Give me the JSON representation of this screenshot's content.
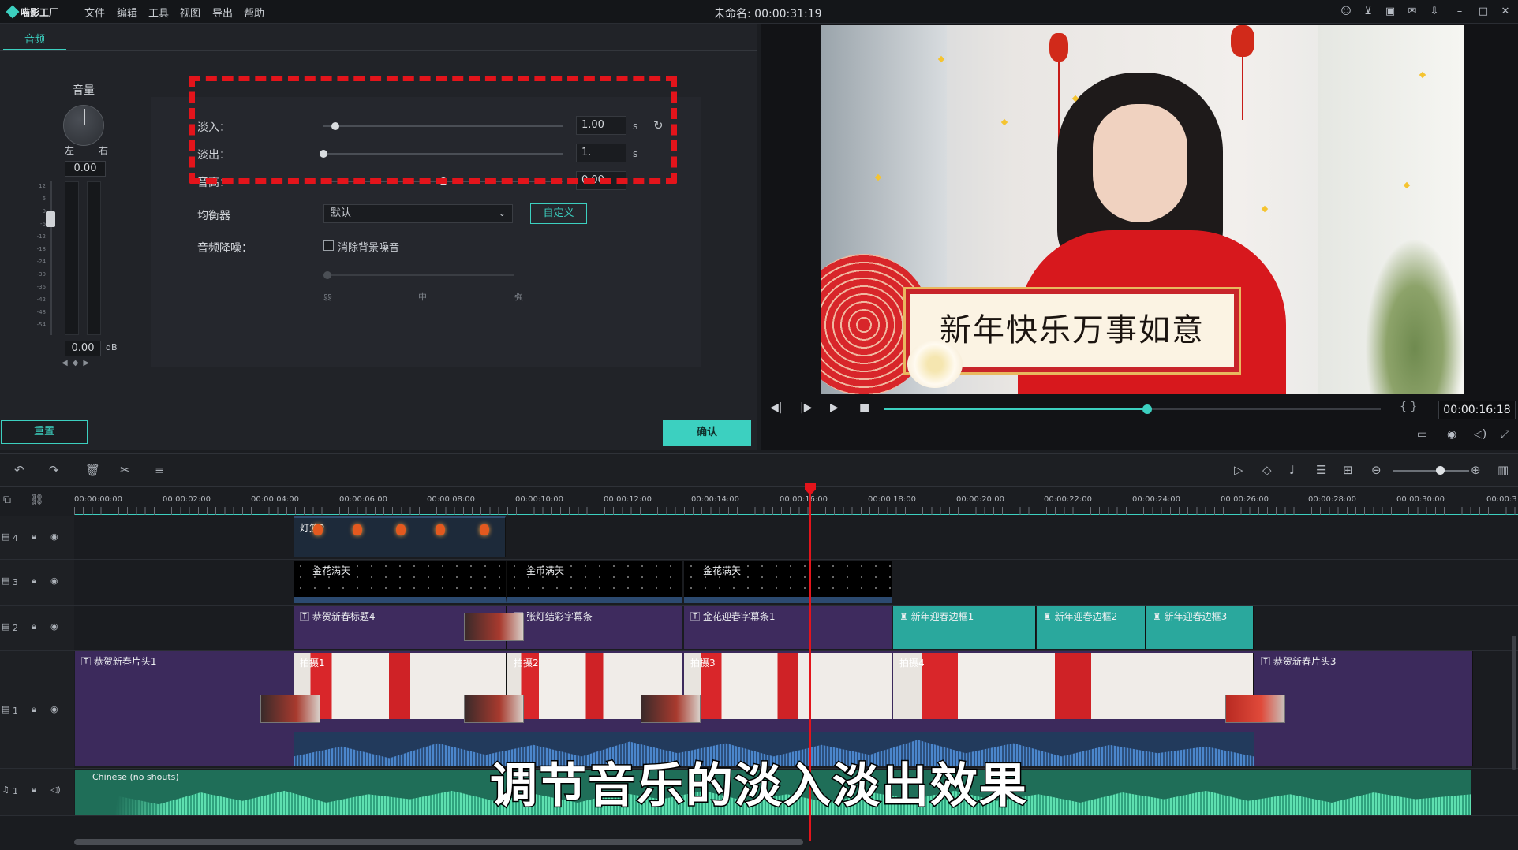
{
  "app": {
    "logo_text": "喵影工厂",
    "menu": [
      "文件",
      "编辑",
      "工具",
      "视图",
      "导出",
      "帮助"
    ],
    "document_title": "未命名: 00:00:31:19",
    "titlebar_icons": [
      "user-icon",
      "cart-icon",
      "save-icon",
      "mail-icon",
      "download-icon",
      "minimize-icon",
      "maximize-icon",
      "close-icon"
    ]
  },
  "audio_panel": {
    "tab_label": "音频",
    "volume_label": "音量",
    "pan_left": "左",
    "pan_right": "右",
    "pan_value": "0.00",
    "volume_value": "0.00",
    "volume_unit": "dB",
    "fade_in": {
      "label": "淡入：",
      "value": "1.00",
      "unit": "s",
      "fraction": 0.05
    },
    "fade_out": {
      "label": "淡出：",
      "value": "1.",
      "unit": "s",
      "fraction": 0.0
    },
    "pitch": {
      "label": "音高：",
      "value": "0.00",
      "fraction": 0.5
    },
    "equalizer": {
      "label": "均衡器",
      "value": "默认",
      "custom_button": "自定义"
    },
    "denoise": {
      "label": "音频降噪：",
      "checkbox_label": "消除背景噪音",
      "checked": false,
      "levels": [
        "弱",
        "中",
        "强"
      ]
    },
    "reset_button": "重置",
    "confirm_button": "确认",
    "highlight_color": "#e3141b",
    "accent_color": "#3cd0c0"
  },
  "preview": {
    "banner_text": "新年快乐万事如意",
    "timecode": "00:00:16:18",
    "progress_fraction": 0.53,
    "bracket_text": "{ }"
  },
  "timeline": {
    "ruler_labels": [
      "00:00:00:00",
      "00:00:02:00",
      "00:00:04:00",
      "00:00:06:00",
      "00:00:08:00",
      "00:00:10:00",
      "00:00:12:00",
      "00:00:14:00",
      "00:00:16:00",
      "00:00:18:00",
      "00:00:20:00",
      "00:00:22:00",
      "00:00:24:00",
      "00:00:26:00",
      "00:00:28:00",
      "00:00:30:00",
      "00:00:3"
    ],
    "tracks": [
      {
        "id": "4",
        "clips": [
          {
            "label": "灯笼2"
          }
        ]
      },
      {
        "id": "3",
        "clips": [
          {
            "label": "金花满天"
          },
          {
            "label": "金币满天"
          },
          {
            "label": "金花满天"
          }
        ]
      },
      {
        "id": "2",
        "clips": [
          {
            "label": "恭贺新春标题4"
          },
          {
            "label": "张灯结彩字幕条"
          },
          {
            "label": "金花迎春字幕条1"
          },
          {
            "label": "新年迎春边框1"
          },
          {
            "label": "新年迎春边框2"
          },
          {
            "label": "新年迎春边框3"
          }
        ]
      },
      {
        "id": "1",
        "clips": [
          {
            "label": "恭贺新春片头1"
          },
          {
            "label": "拍摄1"
          },
          {
            "label": "拍摄2"
          },
          {
            "label": "拍摄3"
          },
          {
            "label": "拍摄4"
          },
          {
            "label": "恭贺新春片头3"
          }
        ]
      },
      {
        "id": "1",
        "clips": [
          {
            "label": "Chinese (no shouts)"
          }
        ]
      }
    ],
    "subtitle": "调节音乐的淡入淡出效果"
  }
}
